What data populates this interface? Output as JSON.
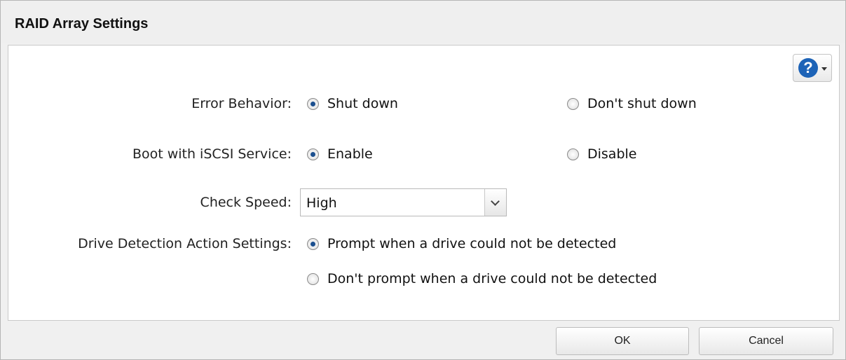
{
  "dialog": {
    "title": "RAID Array Settings",
    "help_icon_glyph": "?",
    "help_icon": "question-circle-icon"
  },
  "fields": {
    "error_behavior": {
      "label": "Error Behavior:",
      "options": [
        "Shut down",
        "Don't shut down"
      ],
      "selected": "Shut down"
    },
    "boot_iscsi": {
      "label": "Boot with iSCSI Service:",
      "options": [
        "Enable",
        "Disable"
      ],
      "selected": "Enable"
    },
    "check_speed": {
      "label": "Check Speed:",
      "value": "High"
    },
    "drive_detection": {
      "label": "Drive Detection Action Settings:",
      "options": [
        "Prompt when a drive could not be detected",
        "Don't prompt when a drive could not be detected"
      ],
      "selected": "Prompt when a drive could not be detected"
    }
  },
  "buttons": {
    "ok": "OK",
    "cancel": "Cancel"
  },
  "colors": {
    "accent": "#1d63b7",
    "radio_dot": "#1b4f8f"
  }
}
